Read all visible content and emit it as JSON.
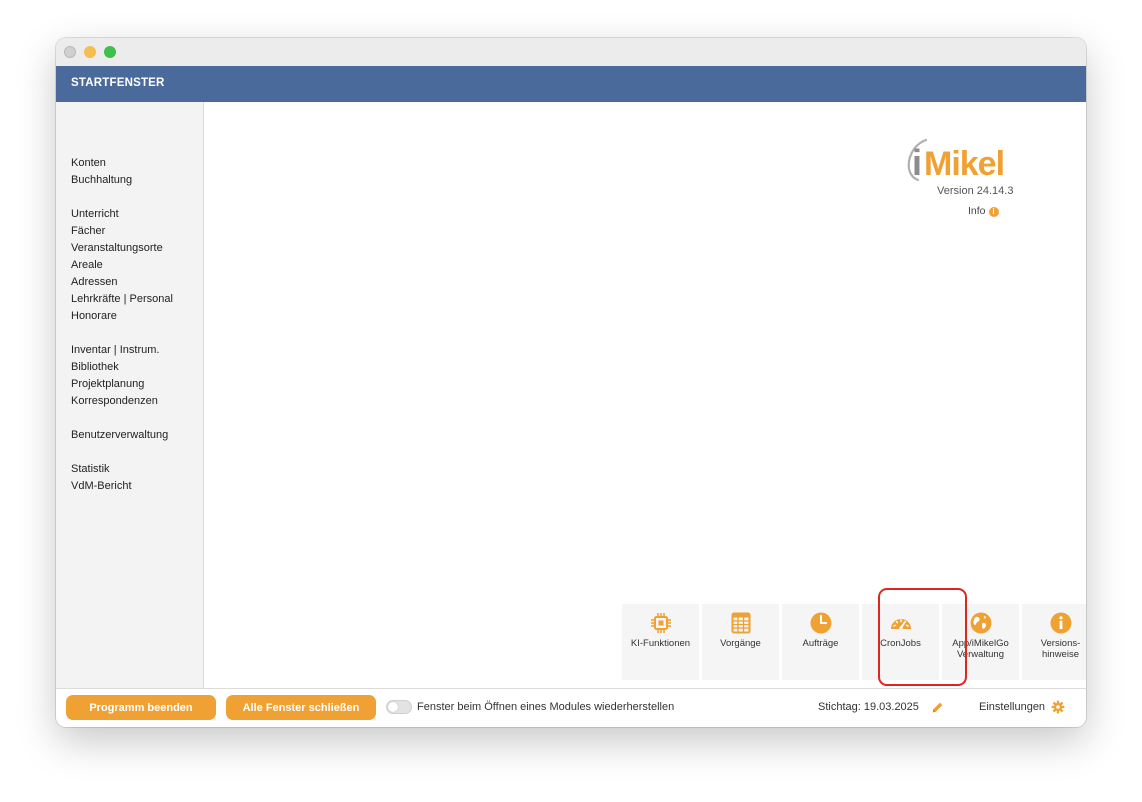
{
  "window": {
    "title": "STARTFENSTER"
  },
  "sidebar": {
    "groups": [
      [
        "Konten",
        "Buchhaltung"
      ],
      [
        "Unterricht",
        "Fächer",
        "Veranstaltungsorte",
        "Areale",
        "Adressen",
        "Lehrkräfte | Personal",
        "Honorare"
      ],
      [
        "Inventar | Instrum.",
        "Bibliothek",
        "Projektplanung",
        "Korrespondenzen"
      ],
      [
        "Benutzerverwaltung"
      ],
      [
        "Statistik",
        "VdM-Bericht"
      ]
    ]
  },
  "brand": {
    "logo_text": "iMikel",
    "version": "Version 24.14.3",
    "info_label": "Info",
    "info_icon": "info-circle-icon"
  },
  "tiles": [
    {
      "label": "KI-Funktionen",
      "icon": "chip-icon"
    },
    {
      "label": "Vorgänge",
      "icon": "table-icon"
    },
    {
      "label": "Aufträge",
      "icon": "clock-icon"
    },
    {
      "label": "CronJobs",
      "icon": "gauge-icon"
    },
    {
      "label": "App/iMikelGo\nVerwaltung",
      "icon": "globe-icon"
    },
    {
      "label": "Versions-\nhinweise",
      "icon": "info-icon"
    }
  ],
  "footer": {
    "quit_label": "Programm beenden",
    "close_all_label": "Alle Fenster schließen",
    "restore_toggle_label": "Fenster beim Öffnen eines Modules wiederherstellen",
    "restore_toggle_on": false,
    "stichtag_label": "Stichtag: 19.03.2025",
    "settings_label": "Einstellungen"
  },
  "colors": {
    "accent": "#f0a134",
    "header": "#4a6a9c",
    "highlight": "#e0251f",
    "sidebar_bg": "#f3f3f3"
  }
}
